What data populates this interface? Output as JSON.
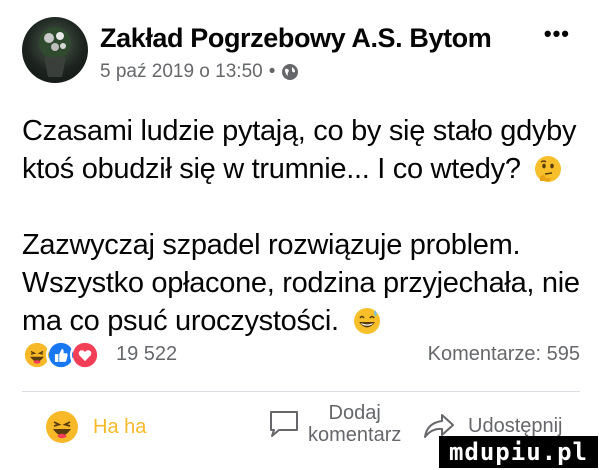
{
  "header": {
    "page_name": "Zakład Pogrzebowy A.S. Bytom",
    "timestamp": "5 paź 2019 o 13:50",
    "separator": "•",
    "audience_icon": "globe-icon",
    "more_label": "•••"
  },
  "post": {
    "paragraph1": "Czasami ludzie pytają, co by się stało gdyby ktoś obudził się w trumnie... I co wtedy?",
    "paragraph1_emoji": "thinking-face-icon",
    "paragraph2": "Zazwyczaj szpadel rozwiązuje problem. Wszystko opłacone, rodzina przyjechała, nie ma co psuć uroczystości.",
    "paragraph2_emoji": "grinning-sweat-face-icon"
  },
  "reactions": {
    "icons": [
      "haha-icon",
      "like-icon",
      "love-icon"
    ],
    "count": "19 522",
    "comments": "Komentarze: 595"
  },
  "actions": {
    "haha_label": "Ha ha",
    "comment_label_line1": "Dodaj",
    "comment_label_line2": "komentarz",
    "share_label": "Udostępnij"
  },
  "watermark": "mdupiu.pl",
  "colors": {
    "text": "#050505",
    "secondary": "#65676b",
    "haha": "#f7b928",
    "like": "#1877f2",
    "love": "#f33e58"
  }
}
